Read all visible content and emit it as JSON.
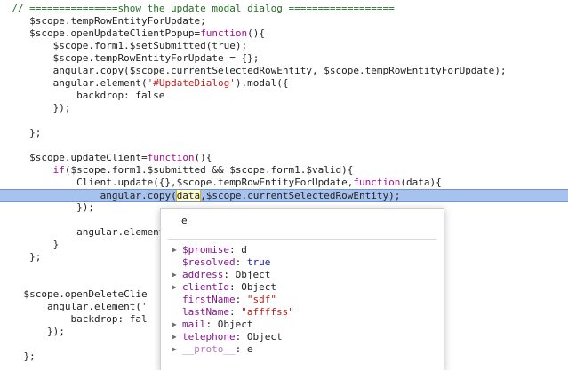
{
  "code_lines": [
    {
      "indent": "  ",
      "tokens": [
        {
          "t": "// ===============show the update modal dialog ==================",
          "c": "comment"
        }
      ]
    },
    {
      "indent": "     ",
      "tokens": [
        {
          "t": "$scope.tempRowEntityForUpdate;",
          "c": "plain"
        }
      ]
    },
    {
      "indent": "     ",
      "tokens": [
        {
          "t": "$scope.openUpdateClientPopup=",
          "c": "plain"
        },
        {
          "t": "function",
          "c": "keyword"
        },
        {
          "t": "(){",
          "c": "plain"
        }
      ]
    },
    {
      "indent": "         ",
      "tokens": [
        {
          "t": "$scope.form1.$setSubmitted(true);",
          "c": "plain"
        }
      ]
    },
    {
      "indent": "         ",
      "tokens": [
        {
          "t": "$scope.tempRowEntityForUpdate = {};",
          "c": "plain"
        }
      ]
    },
    {
      "indent": "         ",
      "tokens": [
        {
          "t": "angular.copy($scope.currentSelectedRowEntity, $scope.tempRowEntityForUpdate);",
          "c": "plain"
        }
      ]
    },
    {
      "indent": "         ",
      "tokens": [
        {
          "t": "angular.element(",
          "c": "plain"
        },
        {
          "t": "'#UpdateDialog'",
          "c": "string"
        },
        {
          "t": ").modal({",
          "c": "plain"
        }
      ]
    },
    {
      "indent": "             ",
      "tokens": [
        {
          "t": "backdrop: false",
          "c": "plain"
        }
      ]
    },
    {
      "indent": "         ",
      "tokens": [
        {
          "t": "});",
          "c": "plain"
        }
      ]
    },
    {
      "indent": "",
      "tokens": []
    },
    {
      "indent": "     ",
      "tokens": [
        {
          "t": "};",
          "c": "plain"
        }
      ]
    },
    {
      "indent": "",
      "tokens": []
    },
    {
      "indent": "     ",
      "tokens": [
        {
          "t": "$scope.updateClient=",
          "c": "plain"
        },
        {
          "t": "function",
          "c": "keyword"
        },
        {
          "t": "(){",
          "c": "plain"
        }
      ]
    },
    {
      "indent": "         ",
      "tokens": [
        {
          "t": "if",
          "c": "keyword"
        },
        {
          "t": "($scope.form1.$submitted && $scope.form1.$valid){",
          "c": "plain"
        }
      ]
    },
    {
      "indent": "             ",
      "tokens": [
        {
          "t": "Client.update({},$scope.tempRowEntityForUpdate,",
          "c": "plain"
        },
        {
          "t": "function",
          "c": "keyword"
        },
        {
          "t": "(data){",
          "c": "plain"
        }
      ]
    },
    {
      "indent": "                 ",
      "current": true,
      "tokens": [
        {
          "t": "angular.copy(",
          "c": "plain"
        },
        {
          "t": "data",
          "c": "hl"
        },
        {
          "t": ",$scope.currentSelectedRowEntity);",
          "c": "plain"
        }
      ]
    },
    {
      "indent": "             ",
      "tokens": [
        {
          "t": "});",
          "c": "plain"
        }
      ]
    },
    {
      "indent": "",
      "tokens": []
    },
    {
      "indent": "             ",
      "tokens": [
        {
          "t": "angular.element",
          "c": "plain"
        }
      ]
    },
    {
      "indent": "         ",
      "tokens": [
        {
          "t": "}",
          "c": "plain"
        }
      ]
    },
    {
      "indent": "     ",
      "tokens": [
        {
          "t": "};",
          "c": "plain"
        }
      ]
    },
    {
      "indent": "",
      "tokens": []
    },
    {
      "indent": "",
      "tokens": []
    },
    {
      "indent": "    ",
      "tokens": [
        {
          "t": "$scope.openDeleteClie",
          "c": "plain"
        }
      ]
    },
    {
      "indent": "        ",
      "tokens": [
        {
          "t": "angular.element(",
          "c": "plain"
        },
        {
          "t": "'",
          "c": "string"
        }
      ]
    },
    {
      "indent": "            ",
      "tokens": [
        {
          "t": "backdrop: fal",
          "c": "plain"
        }
      ]
    },
    {
      "indent": "        ",
      "tokens": [
        {
          "t": "});",
          "c": "plain"
        }
      ]
    },
    {
      "indent": "",
      "tokens": []
    },
    {
      "indent": "    ",
      "tokens": [
        {
          "t": "};",
          "c": "plain"
        }
      ]
    }
  ],
  "popover": {
    "title": "e",
    "properties": [
      {
        "key": "$promise",
        "value": "d",
        "type": "object",
        "expandable": true,
        "faded": false
      },
      {
        "key": "$resolved",
        "value": "true",
        "type": "bool",
        "expandable": false,
        "faded": false
      },
      {
        "key": "address",
        "value": "Object",
        "type": "object",
        "expandable": true,
        "faded": false
      },
      {
        "key": "clientId",
        "value": "Object",
        "type": "object",
        "expandable": true,
        "faded": false
      },
      {
        "key": "firstName",
        "value": "\"sdf\"",
        "type": "string",
        "expandable": false,
        "faded": false
      },
      {
        "key": "lastName",
        "value": "\"affffss\"",
        "type": "string",
        "expandable": false,
        "faded": false
      },
      {
        "key": "mail",
        "value": "Object",
        "type": "object",
        "expandable": true,
        "faded": false
      },
      {
        "key": "telephone",
        "value": "Object",
        "type": "object",
        "expandable": true,
        "faded": false
      },
      {
        "key": "__proto__",
        "value": "e",
        "type": "object",
        "expandable": true,
        "faded": true
      }
    ]
  }
}
